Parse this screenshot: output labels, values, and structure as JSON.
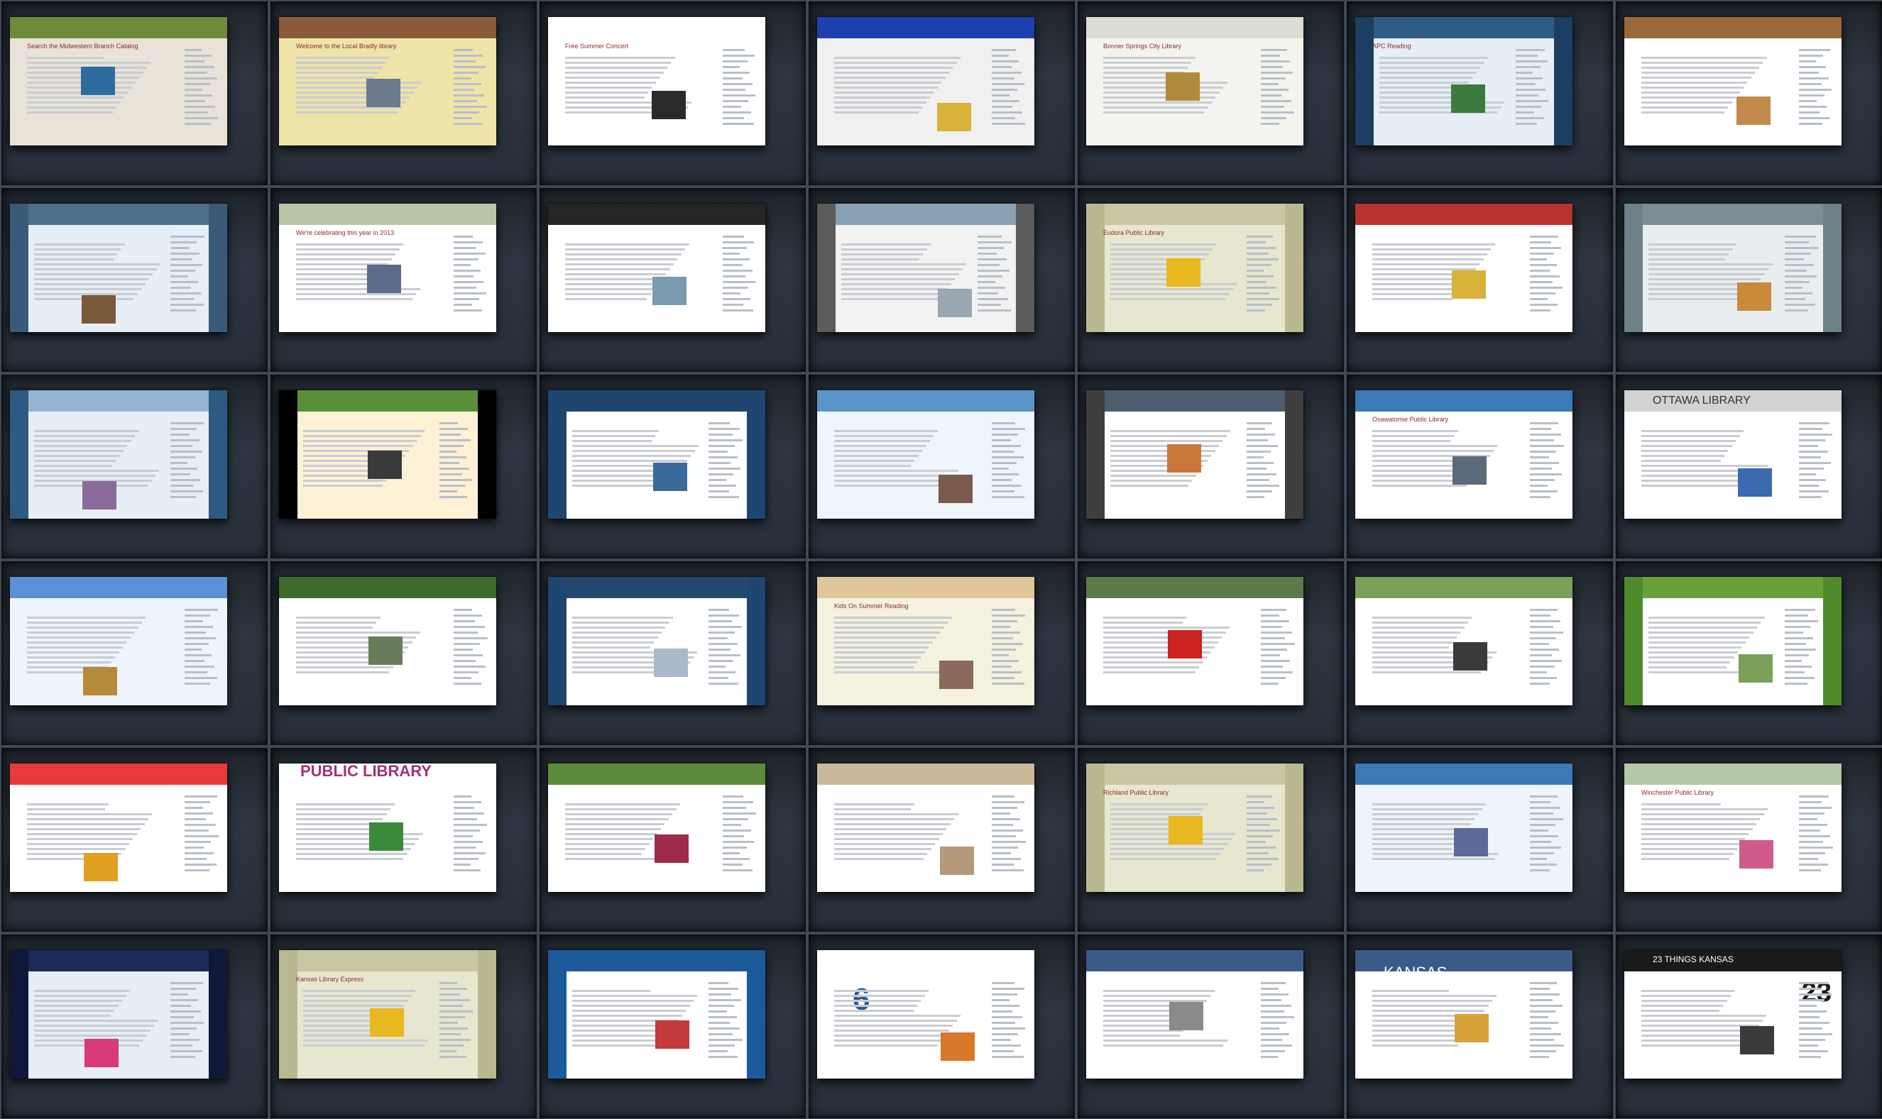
{
  "colors": {
    "background": "#2b333c",
    "frame": "#27303a"
  },
  "grid": {
    "rows": 6,
    "cols": 7
  },
  "thumbnails": [
    {
      "theme": "#e8e2d8",
      "band": "#6e8a3a",
      "side": "",
      "title": "Search the Midwestern Branch Catalog",
      "text": "",
      "num": "",
      "img": "#2e6b9e"
    },
    {
      "theme": "#efe4a8",
      "band": "#8a5a3a",
      "side": "",
      "title": "Welcome to the Local Bradly library",
      "text": "",
      "num": "",
      "img": "#6a7b8c"
    },
    {
      "theme": "#ffffff",
      "band": "#ffffff",
      "side": "",
      "title": "Free Summer Concert",
      "text": "",
      "num": "",
      "img": "#2a2a2a"
    },
    {
      "theme": "#f0f0f0",
      "band": "#1e3fb0",
      "side": "",
      "title": "",
      "text": "",
      "num": "",
      "img": "#d9b23a"
    },
    {
      "theme": "#f4f4ef",
      "band": "#dcdcd4",
      "side": "",
      "title": "Bonner Springs City Library",
      "text": "",
      "num": "",
      "img": "#b08a3a"
    },
    {
      "theme": "#e6eef6",
      "band": "#2f5b86",
      "side": "#1c3e62",
      "title": "APC Reading",
      "text": "",
      "num": "",
      "img": "#3d7a3d"
    },
    {
      "theme": "#ffffff",
      "band": "#9a6a3a",
      "side": "",
      "title": "",
      "text": "",
      "num": "",
      "img": "#c28a4a"
    },
    {
      "theme": "#e6eef6",
      "band": "#4d6f8e",
      "side": "#3a5a7a",
      "title": "",
      "text": "",
      "num": "",
      "img": "#7a5a3a"
    },
    {
      "theme": "#ffffff",
      "band": "#b7c7a6",
      "side": "",
      "title": "We're celebrating this year in 2013",
      "text": "",
      "num": "",
      "img": "#5b6b8b"
    },
    {
      "theme": "#ffffff",
      "band": "#262626",
      "side": "",
      "title": "",
      "text": "",
      "num": "",
      "img": "#7a9ab0"
    },
    {
      "theme": "#f2f2f2",
      "band": "#8aa0b3",
      "side": "#5b5b5b",
      "title": "",
      "text": "",
      "num": "",
      "img": "#9aa6b0"
    },
    {
      "theme": "#e7e6cf",
      "band": "#c9c7a1",
      "side": "#b9b890",
      "title": "Eudora Public Library",
      "text": "",
      "num": "",
      "img": "#e8b820"
    },
    {
      "theme": "#ffffff",
      "band": "#b8322f",
      "side": "",
      "title": "",
      "text": "",
      "num": "",
      "img": "#d9b23a"
    },
    {
      "theme": "#e8eef0",
      "band": "#7a8e93",
      "side": "#6d8186",
      "title": "",
      "text": "",
      "num": "",
      "img": "#c98a3a"
    },
    {
      "theme": "#e6eef6",
      "band": "#94b4cf",
      "side": "#2d5a83",
      "title": "",
      "text": "",
      "num": "",
      "img": "#8a6a9a"
    },
    {
      "theme": "#fdf1d6",
      "band": "#5a8f3a",
      "side": "#000000",
      "title": "",
      "text": "",
      "num": "",
      "img": "#3a3a3a"
    },
    {
      "theme": "#ffffff",
      "band": "#1e4670",
      "side": "#1e4670",
      "title": "",
      "text": "",
      "num": "",
      "img": "#3a6a9a"
    },
    {
      "theme": "#eef5fb",
      "band": "#5a95c9",
      "side": "",
      "title": "",
      "text": "",
      "num": "",
      "img": "#7a5a4a"
    },
    {
      "theme": "#ffffff",
      "band": "#4d5d6e",
      "side": "#3f3f3f",
      "title": "",
      "text": "",
      "num": "",
      "img": "#c9763a"
    },
    {
      "theme": "#ffffff",
      "band": "#3b79b7",
      "side": "",
      "title": "Osawatomie Public Library",
      "text": "",
      "num": "",
      "img": "#5b6a7a"
    },
    {
      "theme": "#ffffff",
      "band": "#d2d2d2",
      "side": "",
      "title": "OTTAWA LIBRARY",
      "text": "",
      "num": "",
      "img": "#3a6ab0"
    },
    {
      "theme": "#eef4fb",
      "band": "#5b8fd6",
      "side": "",
      "title": "",
      "text": "",
      "num": "",
      "img": "#b58a3a"
    },
    {
      "theme": "#ffffff",
      "band": "#3f6b2a",
      "side": "",
      "title": "",
      "text": "",
      "num": "",
      "img": "#6a7b5b"
    },
    {
      "theme": "#ffffff",
      "band": "#24476d",
      "side": "#1e4670",
      "title": "",
      "text": "",
      "num": "",
      "img": "#a9b9c9"
    },
    {
      "theme": "#f4f1df",
      "band": "#e0c79a",
      "side": "",
      "title": "Kids On Summer Reading",
      "text": "",
      "num": "",
      "img": "#8a6a5a"
    },
    {
      "theme": "#ffffff",
      "band": "#5b7a4a",
      "side": "",
      "title": "",
      "text": "",
      "num": "",
      "img": "#cc2222"
    },
    {
      "theme": "#ffffff",
      "band": "#7aa05a",
      "side": "",
      "title": "",
      "text": "",
      "num": "",
      "img": "#3a3a3a"
    },
    {
      "theme": "#ffffff",
      "band": "#6aa03a",
      "side": "#4f8a2a",
      "title": "",
      "text": "",
      "num": "",
      "img": "#7aa05a"
    },
    {
      "theme": "#ffffff",
      "band": "#e83a3a",
      "side": "",
      "title": "",
      "text": "",
      "num": "",
      "img": "#e0a020"
    },
    {
      "theme": "#ffffff",
      "band": "#ffffff",
      "side": "",
      "title": "",
      "text": "PUBLIC LIBRARY",
      "num": "",
      "img": "#3a8a3a"
    },
    {
      "theme": "#ffffff",
      "band": "#5b8a3a",
      "side": "",
      "title": "",
      "text": "",
      "num": "",
      "img": "#a02a4a"
    },
    {
      "theme": "#ffffff",
      "band": "#c9b89a",
      "side": "",
      "title": "",
      "text": "",
      "num": "",
      "img": "#b49a7a"
    },
    {
      "theme": "#e7e6cf",
      "band": "#c9c7a1",
      "side": "#b9b890",
      "title": "Richland Public Library",
      "text": "",
      "num": "",
      "img": "#e8b820"
    },
    {
      "theme": "#eef4fb",
      "band": "#3b79b7",
      "side": "",
      "title": "",
      "text": "",
      "num": "",
      "img": "#5b6a9a"
    },
    {
      "theme": "#ffffff",
      "band": "#b5c7a6",
      "side": "",
      "title": "Winchester Public Library",
      "text": "",
      "num": "",
      "img": "#d05a8a"
    },
    {
      "theme": "#e6eef6",
      "band": "#1c2a5a",
      "side": "#10183a",
      "title": "",
      "text": "",
      "num": "",
      "img": "#d83a7a"
    },
    {
      "theme": "#e7e6cf",
      "band": "#c9c7a1",
      "side": "#b9b890",
      "title": "Kansas Library Express",
      "text": "",
      "num": "",
      "img": "#e8b820"
    },
    {
      "theme": "#ffffff",
      "band": "#1d5a9a",
      "side": "#1d5a9a",
      "title": "",
      "text": "",
      "num": "",
      "img": "#c23a3a"
    },
    {
      "theme": "#ffffff",
      "band": "#ffffff",
      "side": "",
      "title": "",
      "text": "",
      "num": "6",
      "img": "#d8762a"
    },
    {
      "theme": "#ffffff",
      "band": "#3a5a8a",
      "side": "",
      "title": "",
      "text": "",
      "num": "",
      "img": "#8a8a8a"
    },
    {
      "theme": "#ffffff",
      "band": "#3a5a8a",
      "side": "",
      "title": "KANSAS",
      "text": "",
      "num": "",
      "img": "#d8a23a"
    },
    {
      "theme": "#ffffff",
      "band": "#1a1a1a",
      "side": "",
      "title": "23 THINGS KANSAS",
      "text": "",
      "num": "23",
      "img": "#3a3a3a"
    }
  ]
}
